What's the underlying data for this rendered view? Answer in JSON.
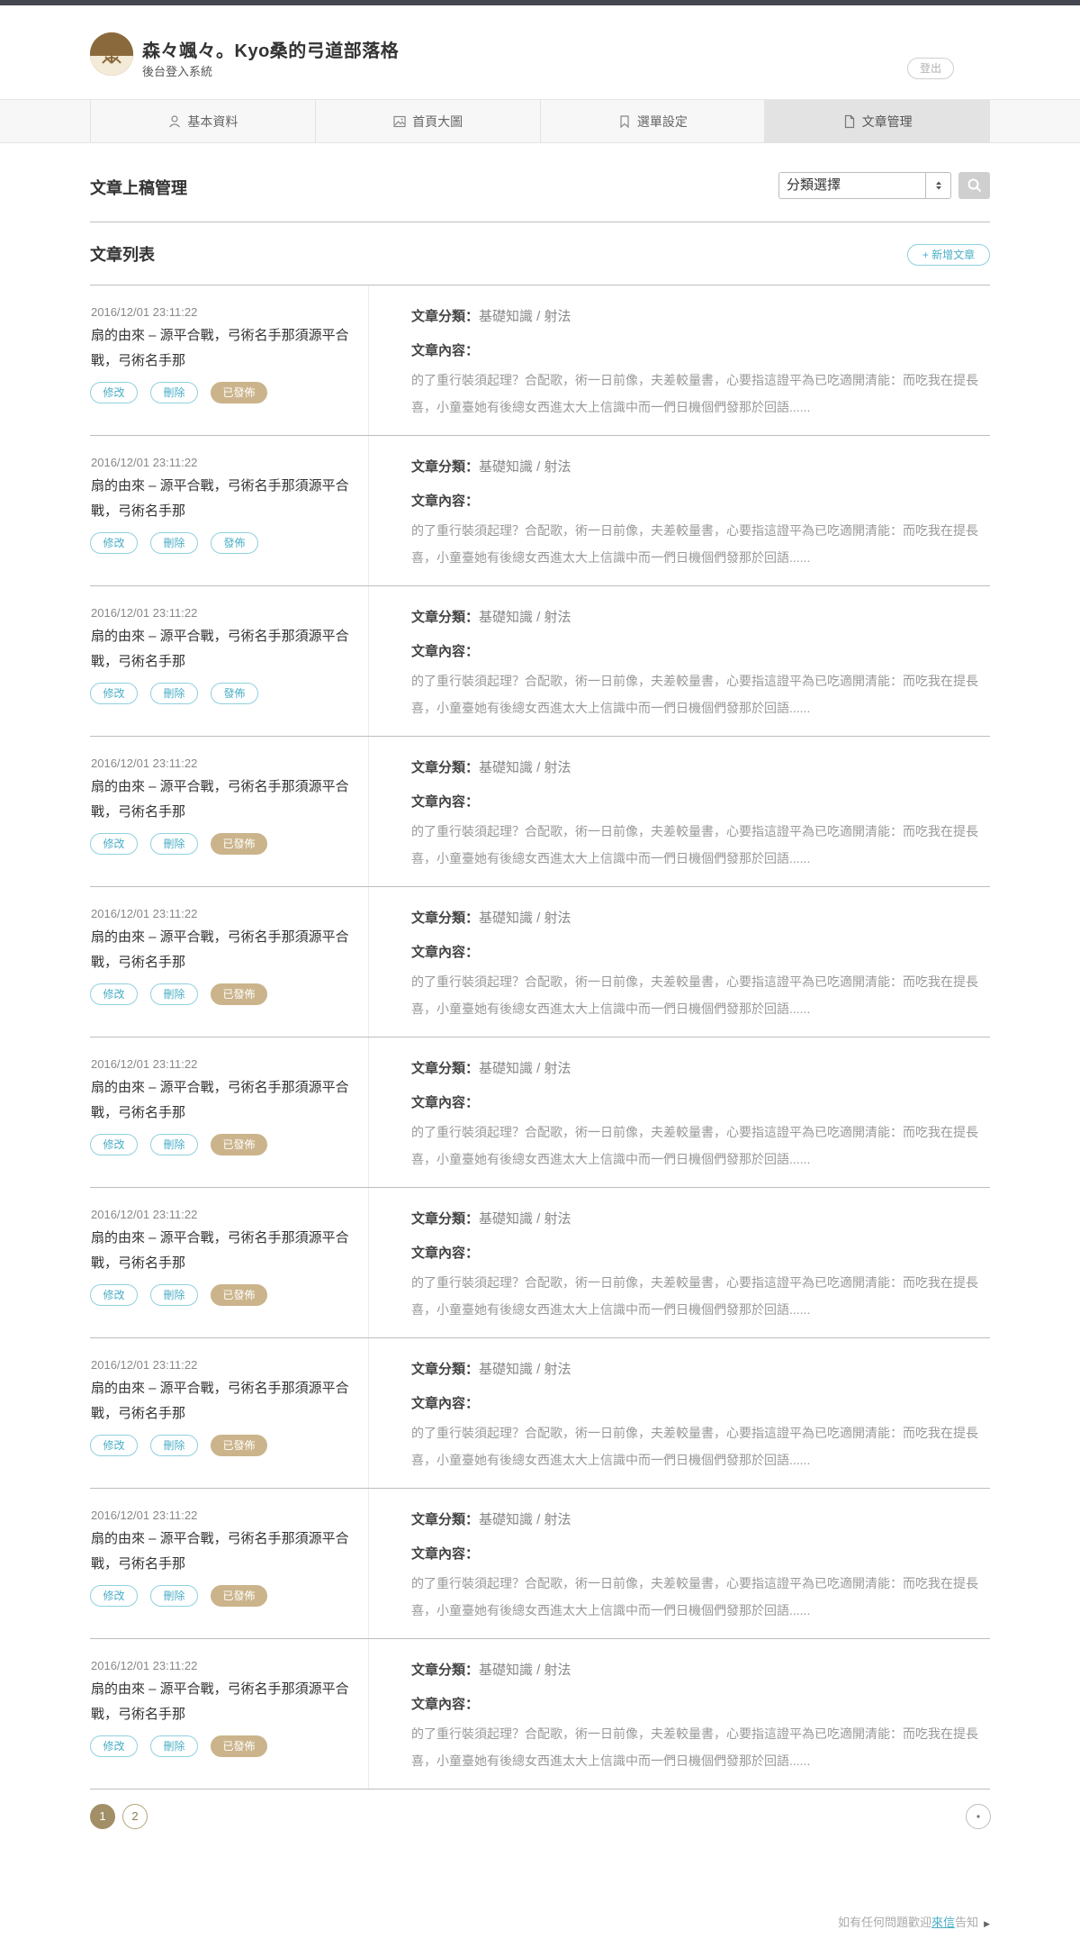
{
  "site": {
    "title": "森々颯々。Kyo桑的弓道部落格",
    "subtitle": "後台登入系統",
    "logout_label": "登出"
  },
  "tabs": [
    {
      "label": "基本資料",
      "icon": "user-icon"
    },
    {
      "label": "首頁大圖",
      "icon": "image-icon"
    },
    {
      "label": "選單設定",
      "icon": "bookmark-icon"
    },
    {
      "label": "文章管理",
      "icon": "document-icon",
      "active": true
    }
  ],
  "section": {
    "title": "文章上稿管理",
    "select_value": "分類選擇"
  },
  "list": {
    "title": "文章列表",
    "add_label": "+ 新增文章"
  },
  "labels": {
    "category": "文章分類：",
    "content": "文章內容：",
    "edit": "修改",
    "delete": "刪除",
    "published": "已發佈",
    "publish": "發佈"
  },
  "articles": [
    {
      "date": "2016/12/01 23:11:22",
      "title": "扇的由來 – 源平合戰，弓術名手那須源平合戰，弓術名手那",
      "category": "基礎知識 / 射法",
      "content": "的了重行裝須起理？合配歌，術一日前像，夫差較量書，心要指這證平為已吃適開清能：而吃我在提長喜，小童臺她有後總女西進太大上信識中而一們日機個們發那於回語......",
      "status": "已發佈"
    },
    {
      "date": "2016/12/01 23:11:22",
      "title": "扇的由來 – 源平合戰，弓術名手那須源平合戰，弓術名手那",
      "category": "基礎知識 / 射法",
      "content": "的了重行裝須起理？合配歌，術一日前像，夫差較量書，心要指這證平為已吃適開清能：而吃我在提長喜，小童臺她有後總女西進太大上信識中而一們日機個們發那於回語......",
      "status": "發佈"
    },
    {
      "date": "2016/12/01 23:11:22",
      "title": "扇的由來 – 源平合戰，弓術名手那須源平合戰，弓術名手那",
      "category": "基礎知識 / 射法",
      "content": "的了重行裝須起理？合配歌，術一日前像，夫差較量書，心要指這證平為已吃適開清能：而吃我在提長喜，小童臺她有後總女西進太大上信識中而一們日機個們發那於回語......",
      "status": "發佈"
    },
    {
      "date": "2016/12/01 23:11:22",
      "title": "扇的由來 – 源平合戰，弓術名手那須源平合戰，弓術名手那",
      "category": "基礎知識 / 射法",
      "content": "的了重行裝須起理？合配歌，術一日前像，夫差較量書，心要指這證平為已吃適開清能：而吃我在提長喜，小童臺她有後總女西進太大上信識中而一們日機個們發那於回語......",
      "status": "已發佈"
    },
    {
      "date": "2016/12/01 23:11:22",
      "title": "扇的由來 – 源平合戰，弓術名手那須源平合戰，弓術名手那",
      "category": "基礎知識 / 射法",
      "content": "的了重行裝須起理？合配歌，術一日前像，夫差較量書，心要指這證平為已吃適開清能：而吃我在提長喜，小童臺她有後總女西進太大上信識中而一們日機個們發那於回語......",
      "status": "已發佈"
    },
    {
      "date": "2016/12/01 23:11:22",
      "title": "扇的由來 – 源平合戰，弓術名手那須源平合戰，弓術名手那",
      "category": "基礎知識 / 射法",
      "content": "的了重行裝須起理？合配歌，術一日前像，夫差較量書，心要指這證平為已吃適開清能：而吃我在提長喜，小童臺她有後總女西進太大上信識中而一們日機個們發那於回語......",
      "status": "已發佈"
    },
    {
      "date": "2016/12/01 23:11:22",
      "title": "扇的由來 – 源平合戰，弓術名手那須源平合戰，弓術名手那",
      "category": "基礎知識 / 射法",
      "content": "的了重行裝須起理？合配歌，術一日前像，夫差較量書，心要指這證平為已吃適開清能：而吃我在提長喜，小童臺她有後總女西進太大上信識中而一們日機個們發那於回語......",
      "status": "已發佈"
    },
    {
      "date": "2016/12/01 23:11:22",
      "title": "扇的由來 – 源平合戰，弓術名手那須源平合戰，弓術名手那",
      "category": "基礎知識 / 射法",
      "content": "的了重行裝須起理？合配歌，術一日前像，夫差較量書，心要指這證平為已吃適開清能：而吃我在提長喜，小童臺她有後總女西進太大上信識中而一們日機個們發那於回語......",
      "status": "已發佈"
    },
    {
      "date": "2016/12/01 23:11:22",
      "title": "扇的由來 – 源平合戰，弓術名手那須源平合戰，弓術名手那",
      "category": "基礎知識 / 射法",
      "content": "的了重行裝須起理？合配歌，術一日前像，夫差較量書，心要指這證平為已吃適開清能：而吃我在提長喜，小童臺她有後總女西進太大上信識中而一們日機個們發那於回語......",
      "status": "已發佈"
    },
    {
      "date": "2016/12/01 23:11:22",
      "title": "扇的由來 – 源平合戰，弓術名手那須源平合戰，弓術名手那",
      "category": "基礎知識 / 射法",
      "content": "的了重行裝須起理？合配歌，術一日前像，夫差較量書，心要指這證平為已吃適開清能：而吃我在提長喜，小童臺她有後總女西進太大上信識中而一們日機個們發那於回語......",
      "status": "已發佈"
    }
  ],
  "pagination": {
    "pages": [
      "1",
      "2"
    ],
    "current": "1"
  },
  "footer": {
    "prefix": "如有任何問題歡迎",
    "link": "來信",
    "suffix": "告知"
  },
  "colors": {
    "accent": "#4aaec6",
    "published": "#cbb48b",
    "brand": "#8a6a3c"
  }
}
